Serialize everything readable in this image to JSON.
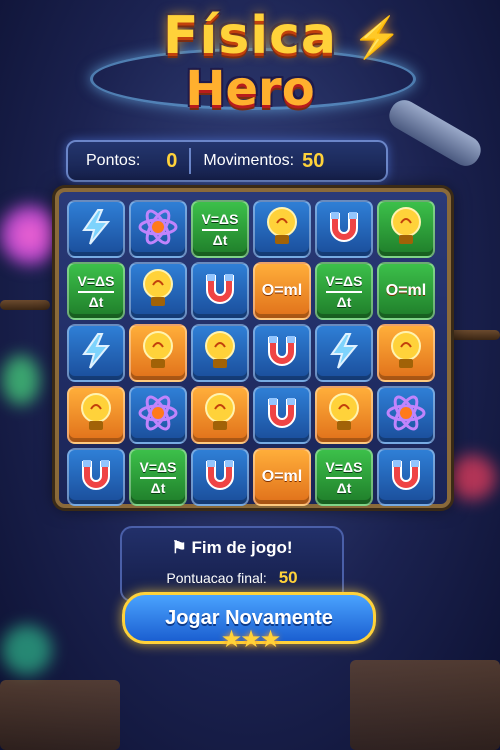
{
  "logo": {
    "line1": "Física",
    "line2": "Hero"
  },
  "scorebar": {
    "points_label": "Pontos:",
    "points_value": "0",
    "moves_label": "Movimentos:",
    "moves_value": "50"
  },
  "board": {
    "rows": [
      [
        "bolt",
        "atom",
        "formula",
        "bulb",
        "magnet",
        "bulb"
      ],
      [
        "formula",
        "bulb",
        "magnet",
        "ohm",
        "formula",
        "ohm"
      ],
      [
        "bolt",
        "bulb",
        "bulb",
        "magnet",
        "bolt",
        "bulb"
      ],
      [
        "bulb",
        "atom",
        "bulb",
        "magnet",
        "bulb",
        "atom"
      ],
      [
        "magnet",
        "formula",
        "magnet",
        "ohm",
        "formula",
        "magnet"
      ]
    ],
    "colors": [
      [
        "blue",
        "blue",
        "green",
        "blue",
        "blue",
        "green"
      ],
      [
        "green",
        "blue",
        "blue",
        "orange",
        "green",
        "green"
      ],
      [
        "blue",
        "orange",
        "blue",
        "blue",
        "blue",
        "orange"
      ],
      [
        "orange",
        "blue",
        "orange",
        "blue",
        "orange",
        "blue"
      ],
      [
        "blue",
        "green",
        "blue",
        "orange",
        "green",
        "blue"
      ]
    ],
    "formula_top": "V=ΔS",
    "formula_bottom": "Δt",
    "ohm_text": "O=ml"
  },
  "end_panel": {
    "title": "Fim de jogo!",
    "score_label": "Pontuacao final:",
    "score_value": "50"
  },
  "play_button": "Jogar Novamente",
  "stars": "★★★",
  "icons": {
    "bolt": "lightning-icon",
    "atom": "atom-icon",
    "bulb": "lightbulb-icon",
    "magnet": "magnet-icon",
    "formula": "formula-tile",
    "ohm": "ohm-tile"
  }
}
